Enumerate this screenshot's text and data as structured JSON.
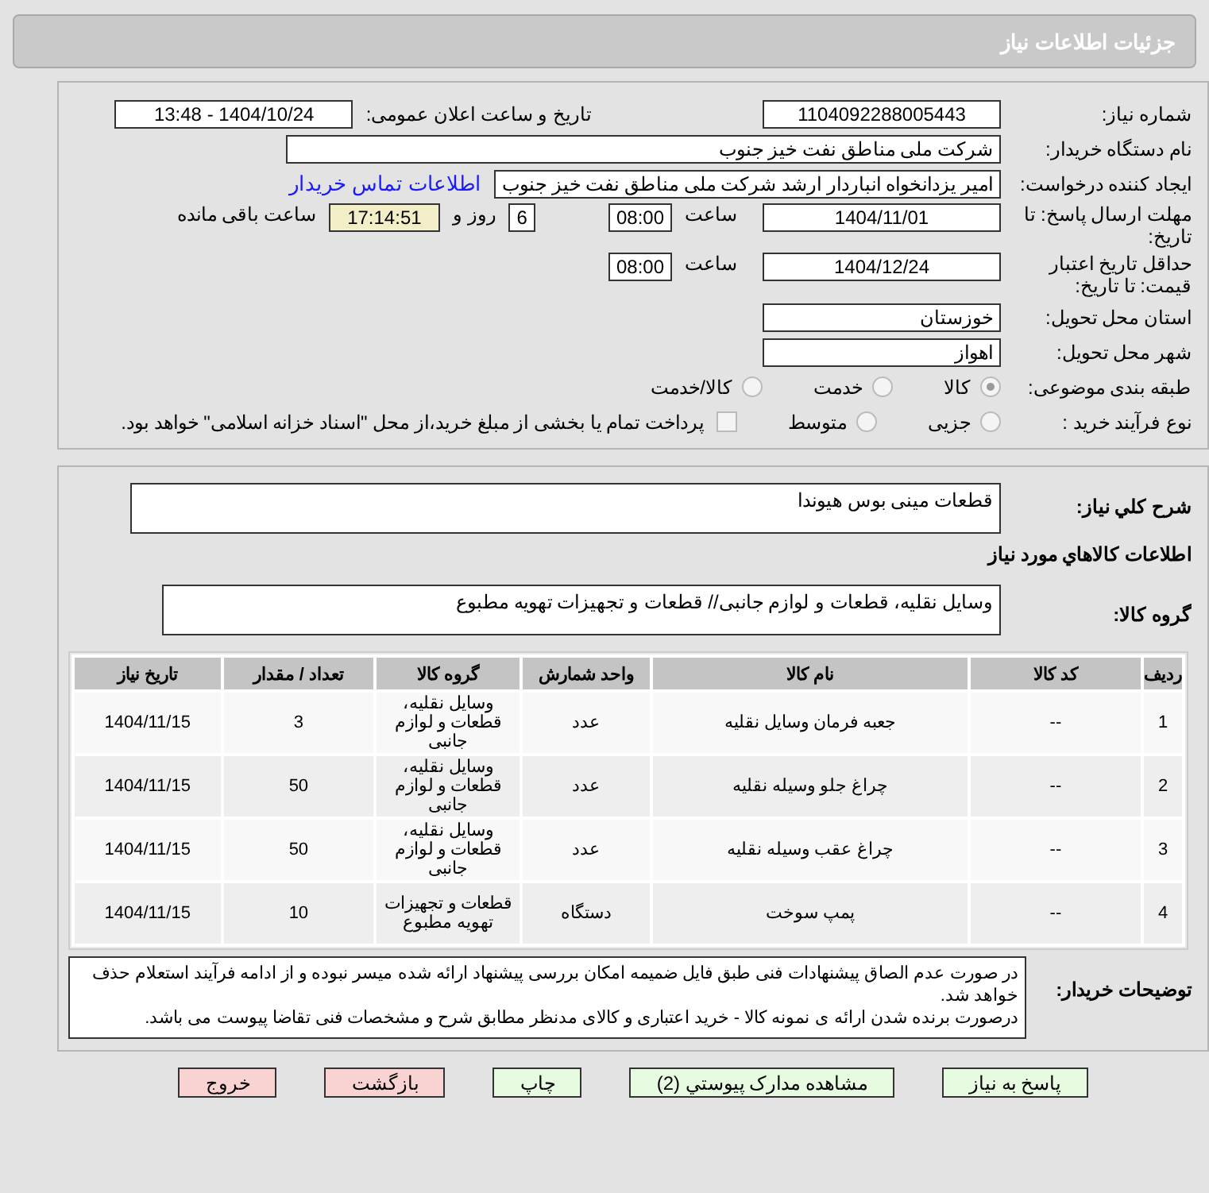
{
  "header": {
    "title": "جزئیات اطلاعات نیاز"
  },
  "need_number": {
    "label": "شماره نیاز:",
    "value": "1104092288005443"
  },
  "announce": {
    "label": "تاریخ و ساعت اعلان عمومی:",
    "value": "1404/10/24 - 13:48"
  },
  "buyer": {
    "label": "نام دستگاه خریدار:",
    "value": "شرکت ملی مناطق نفت خیز جنوب"
  },
  "requester": {
    "label": "ایجاد کننده درخواست:",
    "value": "امیر یزدانخواه انباردار ارشد شرکت ملی مناطق نفت خیز جنوب",
    "link": "اطلاعات تماس خریدار"
  },
  "deadline": {
    "label": "مهلت ارسال پاسخ: تا تاریخ:",
    "date": "1404/11/01",
    "time_label": "ساعت",
    "time": "08:00",
    "days": "6",
    "days_label": "روز و",
    "remaining": "17:14:51",
    "remaining_label": "ساعت باقی مانده"
  },
  "validity": {
    "label": "حداقل تاریخ اعتبار قیمت: تا تاریخ:",
    "date": "1404/12/24",
    "time_label": "ساعت",
    "time": "08:00"
  },
  "province": {
    "label": "استان محل تحویل:",
    "value": "خوزستان"
  },
  "city": {
    "label": "شهر محل تحویل:",
    "value": "اهواز"
  },
  "category": {
    "label": "طبقه بندی موضوعی:",
    "options": [
      {
        "label": "کالا",
        "selected": true
      },
      {
        "label": "خدمت",
        "selected": false
      },
      {
        "label": "کالا/خدمت",
        "selected": false
      }
    ]
  },
  "process": {
    "label": "نوع فرآیند خرید :",
    "options": [
      {
        "label": "جزیی",
        "selected": false
      },
      {
        "label": "متوسط",
        "selected": false
      }
    ],
    "checkbox": {
      "label": "پرداخت تمام یا بخشی از مبلغ خرید،از محل \"اسناد خزانه اسلامی\" خواهد بود.",
      "checked": false
    }
  },
  "description": {
    "label": "شرح کلي نياز:",
    "value": "قطعات مینی بوس هیوندا"
  },
  "goods_title": "اطلاعات کالاهاي مورد نياز",
  "goods_group": {
    "label": "گروه کالا:",
    "value": "وسایل نقلیه، قطعات و لوازم جانبی//  قطعات و تجهیزات تهویه مطبوع"
  },
  "table": {
    "columns": [
      "ردیف",
      "کد کالا",
      "نام کالا",
      "واحد شمارش",
      "گروه کالا",
      "تعداد / مقدار",
      "تاریخ نیاز"
    ],
    "rows": [
      [
        "1",
        "--",
        "جعبه فرمان وسایل نقلیه",
        "عدد",
        "وسایل نقلیه، قطعات و لوازم جانبی",
        "3",
        "1404/11/15"
      ],
      [
        "2",
        "--",
        "چراغ جلو وسیله نقلیه",
        "عدد",
        "وسایل نقلیه، قطعات و لوازم جانبی",
        "50",
        "1404/11/15"
      ],
      [
        "3",
        "--",
        "چراغ عقب وسیله نقلیه",
        "عدد",
        "وسایل نقلیه، قطعات و لوازم جانبی",
        "50",
        "1404/11/15"
      ],
      [
        "4",
        "--",
        "پمپ سوخت",
        "دستگاه",
        "قطعات و تجهیزات تهویه مطبوع",
        "10",
        "1404/11/15"
      ]
    ]
  },
  "notes": {
    "label": "توضیحات خریدار:",
    "paragraphs": [
      "در صورت عدم الصاق پیشنهادات فنی طبق فایل ضمیمه امکان بررسی پیشنهاد ارائه شده میسر نبوده و از ادامه فرآیند استعلام حذف خواهد شد.",
      "درصورت برنده شدن ارائه ی نمونه کالا - خرید اعتباری و کالای مدنظر مطابق شرح و مشخصات فنی تقاضا پیوست می باشد."
    ]
  },
  "buttons": [
    {
      "label": "پاسخ به نیاز",
      "kind": "action"
    },
    {
      "label": "مشاهده مدارک پیوستي (2)",
      "kind": "action"
    },
    {
      "label": "چاپ",
      "kind": "action"
    },
    {
      "label": "بازگشت",
      "kind": "danger"
    },
    {
      "label": "خروج",
      "kind": "danger"
    }
  ]
}
